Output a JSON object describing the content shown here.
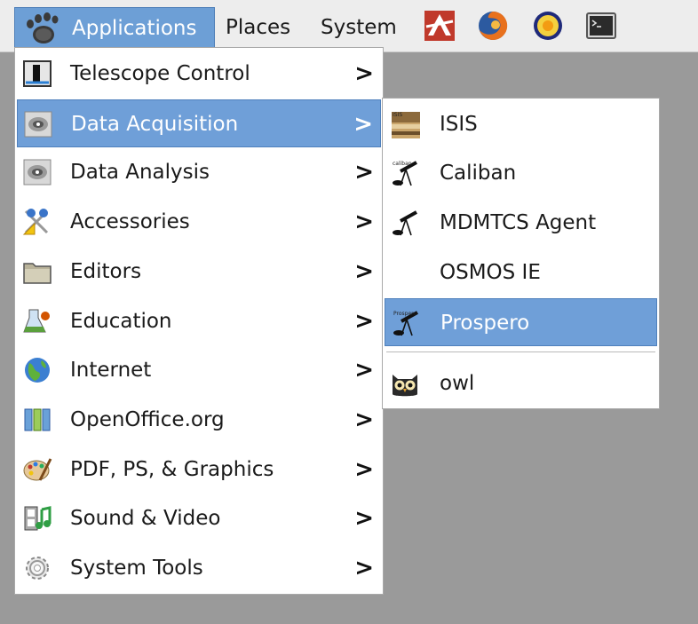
{
  "panel": {
    "applications": "Applications",
    "places": "Places",
    "system": "System",
    "launchers": [
      "app-launcher-icon",
      "firefox-icon",
      "sun-icon",
      "terminal-icon"
    ]
  },
  "main_menu": {
    "arrow": ">",
    "items": [
      {
        "label": "Telescope Control",
        "icon": "telescope-control-icon"
      },
      {
        "label": "Data Acquisition",
        "icon": "galaxy-icon",
        "selected": true
      },
      {
        "label": "Data Analysis",
        "icon": "galaxy-icon"
      },
      {
        "label": "Accessories",
        "icon": "scissors-icon"
      },
      {
        "label": "Editors",
        "icon": "folder-icon"
      },
      {
        "label": "Education",
        "icon": "flask-icon"
      },
      {
        "label": "Internet",
        "icon": "globe-icon"
      },
      {
        "label": "OpenOffice.org",
        "icon": "openoffice-icon"
      },
      {
        "label": "PDF, PS, & Graphics",
        "icon": "palette-icon"
      },
      {
        "label": "Sound & Video",
        "icon": "film-icon"
      },
      {
        "label": "System Tools",
        "icon": "gear-icon"
      }
    ]
  },
  "sub_menu": {
    "items": [
      {
        "label": "ISIS",
        "icon": "isis-icon",
        "icon_text": "ISIS"
      },
      {
        "label": "Caliban",
        "icon": "telescope-icon",
        "icon_text": "caliban"
      },
      {
        "label": "MDMTCS Agent",
        "icon": "telescope-icon"
      },
      {
        "label": "OSMOS IE"
      },
      {
        "label": "Prospero",
        "icon": "telescope-icon",
        "icon_text": "Prospero",
        "selected": true
      },
      {
        "label": "owl",
        "icon": "owl-icon"
      }
    ]
  },
  "colors": {
    "selection": "#6f9fd8",
    "panel_bg": "#ededed",
    "desktop_bg": "#9a9a9a"
  }
}
